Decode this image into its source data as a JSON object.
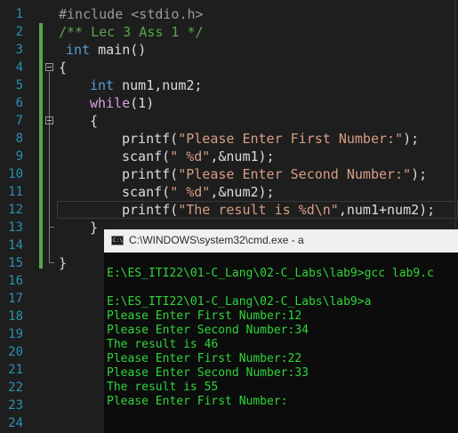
{
  "editor": {
    "line_numbers": [
      "1",
      "2",
      "3",
      "4",
      "5",
      "6",
      "7",
      "8",
      "9",
      "10",
      "11",
      "12",
      "13",
      "14",
      "15",
      "16",
      "17",
      "18",
      "19",
      "20",
      "21",
      "22",
      "23",
      "24"
    ],
    "code": {
      "l1_include": "#include <stdio.h>",
      "l2_comment": "/** Lec 3 Ass 1 */",
      "l3_kw": "int",
      "l3_rest": " main()",
      "l4_brace": "{",
      "l5_kw": "int",
      "l5_rest": " num1,num2;",
      "l6_kw": "while",
      "l6_rest": "(1)",
      "l7_brace": "{",
      "l8_fn": "printf(",
      "l8_str": "\"Please Enter First Number:\"",
      "l8_end": ");",
      "l9_fn": "scanf(",
      "l9_str": "\" %d\"",
      "l9_end": ",&num1);",
      "l10_fn": "printf(",
      "l10_str": "\"Please Enter Second Number:\"",
      "l10_end": ");",
      "l11_fn": "scanf(",
      "l11_str": "\" %d\"",
      "l11_end": ",&num2);",
      "l12_fn": "printf(",
      "l12_str": "\"The result is %d\\n\"",
      "l12_end": ",num1+num2);",
      "l13_brace": "}",
      "l15_brace": "}"
    }
  },
  "console": {
    "title": "C:\\WINDOWS\\system32\\cmd.exe - a",
    "icon": "cmd-window-icon",
    "icon_text": "C:\\",
    "lines": [
      "E:\\ES_ITI22\\01-C_Lang\\02-C_Labs\\lab9>gcc lab9.c",
      "",
      "E:\\ES_ITI22\\01-C_Lang\\02-C_Labs\\lab9>a",
      "Please Enter First Number:12",
      "Please Enter Second Number:34",
      "The result is 46",
      "Please Enter First Number:22",
      "Please Enter Second Number:33",
      "The result is 55",
      "Please Enter First Number:"
    ]
  }
}
